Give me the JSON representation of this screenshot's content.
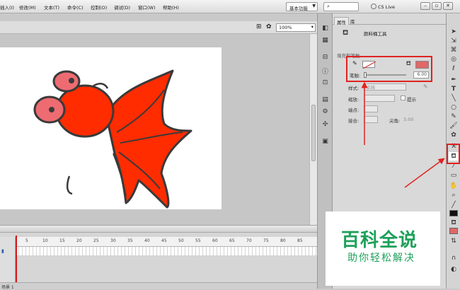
{
  "menubar": {
    "items": [
      "插入(I)",
      "修改(M)",
      "文本(T)",
      "命令(C)",
      "控制(O)",
      "调试(D)",
      "窗口(W)",
      "帮助(H)"
    ],
    "workspace": "基本功能",
    "search_icon": "search-icon",
    "cs_live": "CS Live"
  },
  "stage": {
    "zoom": "100%"
  },
  "timeline": {
    "ticks": [
      "5",
      "10",
      "15",
      "20",
      "25",
      "30",
      "35",
      "40",
      "45",
      "50",
      "55",
      "60",
      "65",
      "70",
      "75",
      "80",
      "85"
    ],
    "scene_label": "场景 1"
  },
  "properties": {
    "tabs": [
      "属性",
      "库"
    ],
    "tool_name": "颜料桶工具",
    "section_fill_stroke": "填充和笔触",
    "stroke_label": "笔触:",
    "stroke_value": "6.00",
    "style_label": "样式:",
    "style_value": "实线",
    "scale_label": "缩放:",
    "hinting_label": "提示",
    "cap_label": "端点:",
    "join_label": "接合:",
    "miter_label": "尖角:",
    "miter_value": "3.00",
    "fill_color": "#e06868"
  },
  "watermark": {
    "title": "百科全说",
    "subtitle": "助你轻松解决"
  },
  "colors": {
    "annotation_red": "#e02222",
    "fish_body": "#ff2c00",
    "fish_eye": "#ee6b72",
    "watermark_green": "#1da05a"
  }
}
